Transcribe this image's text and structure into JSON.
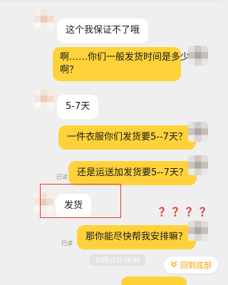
{
  "messages": [
    {
      "side": "left",
      "text": "这个我保证不了哦"
    },
    {
      "side": "right",
      "line1": "啊……你们一般发货时间是多少",
      "line2": "啊？"
    },
    {
      "side": "left",
      "text": "5-7天"
    },
    {
      "side": "right",
      "text": "一件衣服你们发货要5--7天？"
    },
    {
      "side": "right",
      "text": "还是运送加发货要5--7天？",
      "read": "已读"
    },
    {
      "side": "left",
      "text": "发货"
    },
    {
      "side": "right",
      "text": "那你能尽快帮我安排嘛？",
      "read": "已读"
    }
  ],
  "annotation": {
    "question_marks": "？？？？",
    "highlight_color": "#e23b32"
  },
  "timestamp": "10月13日 08:49",
  "back_to_bottom": {
    "label": "回到底部",
    "icon": "chevron-double-down-icon"
  },
  "colors": {
    "background": "#efefef",
    "incoming_bubble": "#ffffff",
    "outgoing_bubble": "#ffd23a",
    "accent": "#f2a100"
  }
}
